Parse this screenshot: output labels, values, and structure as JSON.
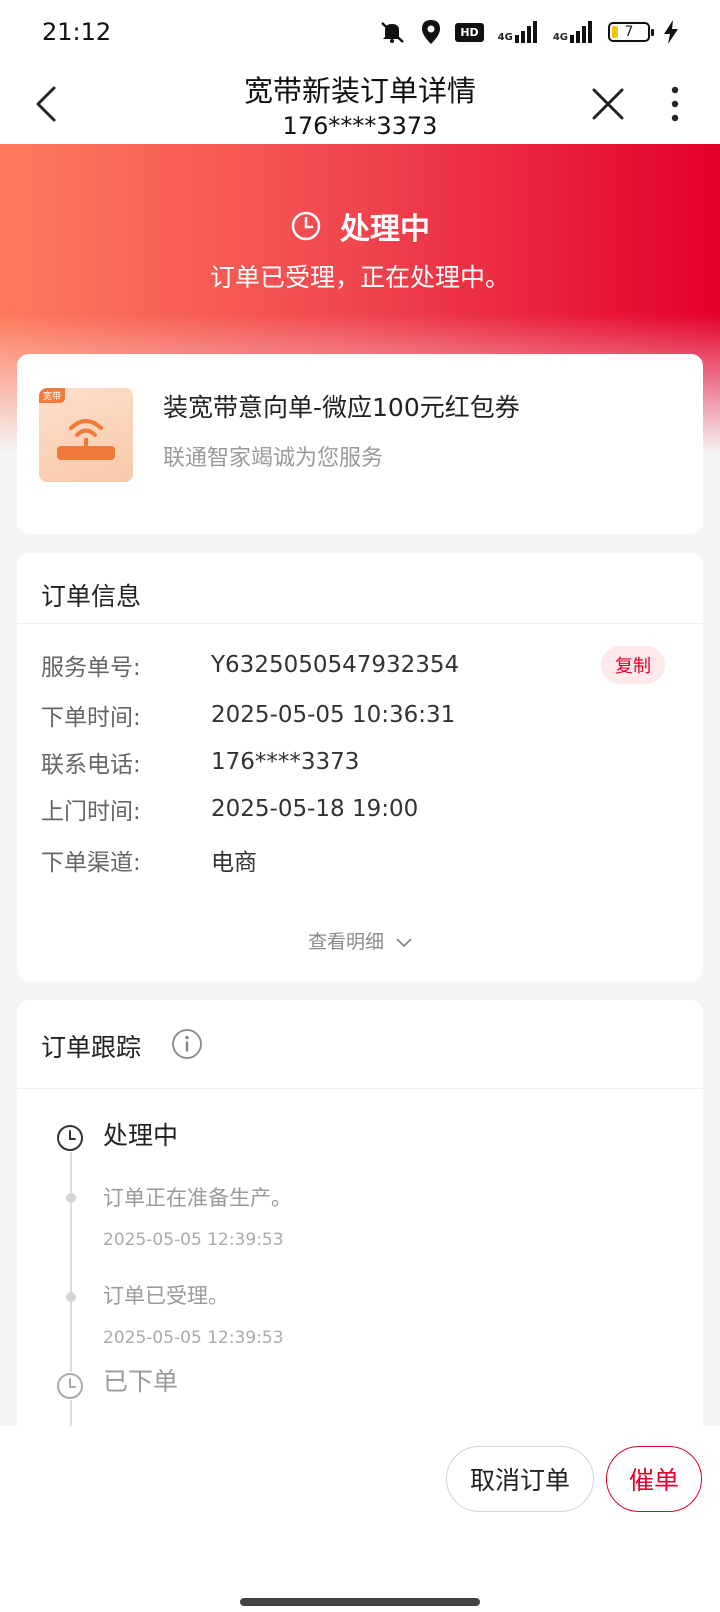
{
  "status_bar": {
    "time": "21:12",
    "hd_label": "HD",
    "signal_1": "4G",
    "signal_2": "4G",
    "battery": "7",
    "icons": [
      "mute-icon",
      "location-icon",
      "hd-icon",
      "signal-icon",
      "signal-icon",
      "battery-icon",
      "charging-icon"
    ]
  },
  "nav": {
    "title": "宽带新装订单详情",
    "subtitle": "176****3373",
    "icons": [
      "back-icon",
      "close-icon",
      "more-icon"
    ]
  },
  "hero": {
    "status": "处理中",
    "description": "订单已受理，正在处理中。",
    "colors": [
      "#ff7a5c",
      "#e4002b"
    ]
  },
  "product": {
    "tag": "宽带",
    "name": "装宽带意向单-微应100元红包券",
    "subtitle": "联通智家竭诚为您服务"
  },
  "order_info": {
    "title": "订单信息",
    "rows": [
      {
        "label": "服务单号:",
        "value": "Y6325050547932354"
      },
      {
        "label": "下单时间:",
        "value": "2025-05-05 10:36:31"
      },
      {
        "label": "联系电话:",
        "value": "176****3373"
      },
      {
        "label": "上门时间:",
        "value": "2025-05-18 19:00"
      },
      {
        "label": "下单渠道:",
        "value": "电商"
      }
    ],
    "copy_label": "复制",
    "detail_link": "查看明细"
  },
  "tracking": {
    "title": "订单跟踪",
    "current_status": "处理中",
    "events": [
      {
        "text": "订单正在准备生产。",
        "time": "2025-05-05 12:39:53"
      },
      {
        "text": "订单已受理。",
        "time": "2025-05-05 12:39:53"
      }
    ],
    "previous_status": "已下单"
  },
  "actions": {
    "cancel": "取消订单",
    "urge": "催单"
  },
  "accent_color": "#e4002b"
}
